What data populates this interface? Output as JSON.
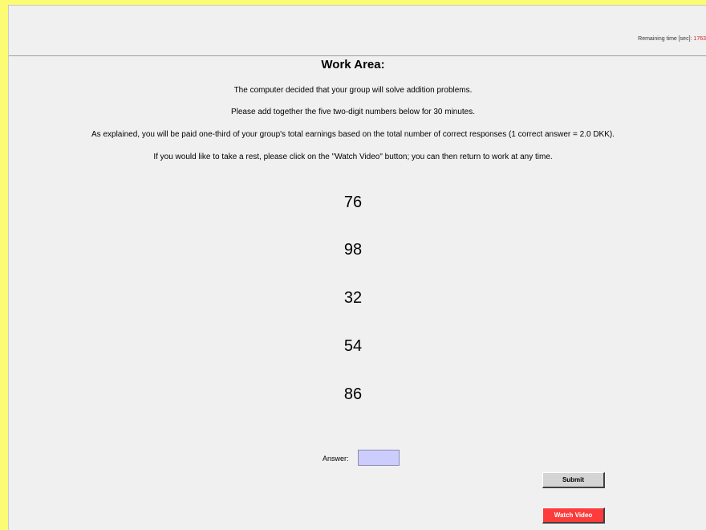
{
  "header": {
    "timer_label": "Remaining time [sec]:",
    "timer_value": "1763"
  },
  "work_area": {
    "title": "Work Area:",
    "instructions": [
      "The computer decided that your group will solve addition problems.",
      "Please add together the five two-digit numbers below for 30 minutes.",
      "As explained, you will be paid one-third of your group's total earnings based on the total number of correct responses (1 correct answer = 2.0 DKK).",
      "If you would like to take a rest, please click on the \"Watch Video\" button; you can then return to work at any time."
    ],
    "numbers": [
      "76",
      "98",
      "32",
      "54",
      "86"
    ]
  },
  "answer": {
    "label": "Answer:",
    "value": ""
  },
  "buttons": {
    "submit_label": "Submit",
    "watch_video_label": "Watch Video"
  },
  "colors": {
    "border_yellow": "#fbfb74",
    "background": "#f0f0f0",
    "input_fill": "#ccccff",
    "watch_video_button": "#ff3b3b",
    "submit_button": "#d4d4d4",
    "timer_value": "#e02020"
  }
}
